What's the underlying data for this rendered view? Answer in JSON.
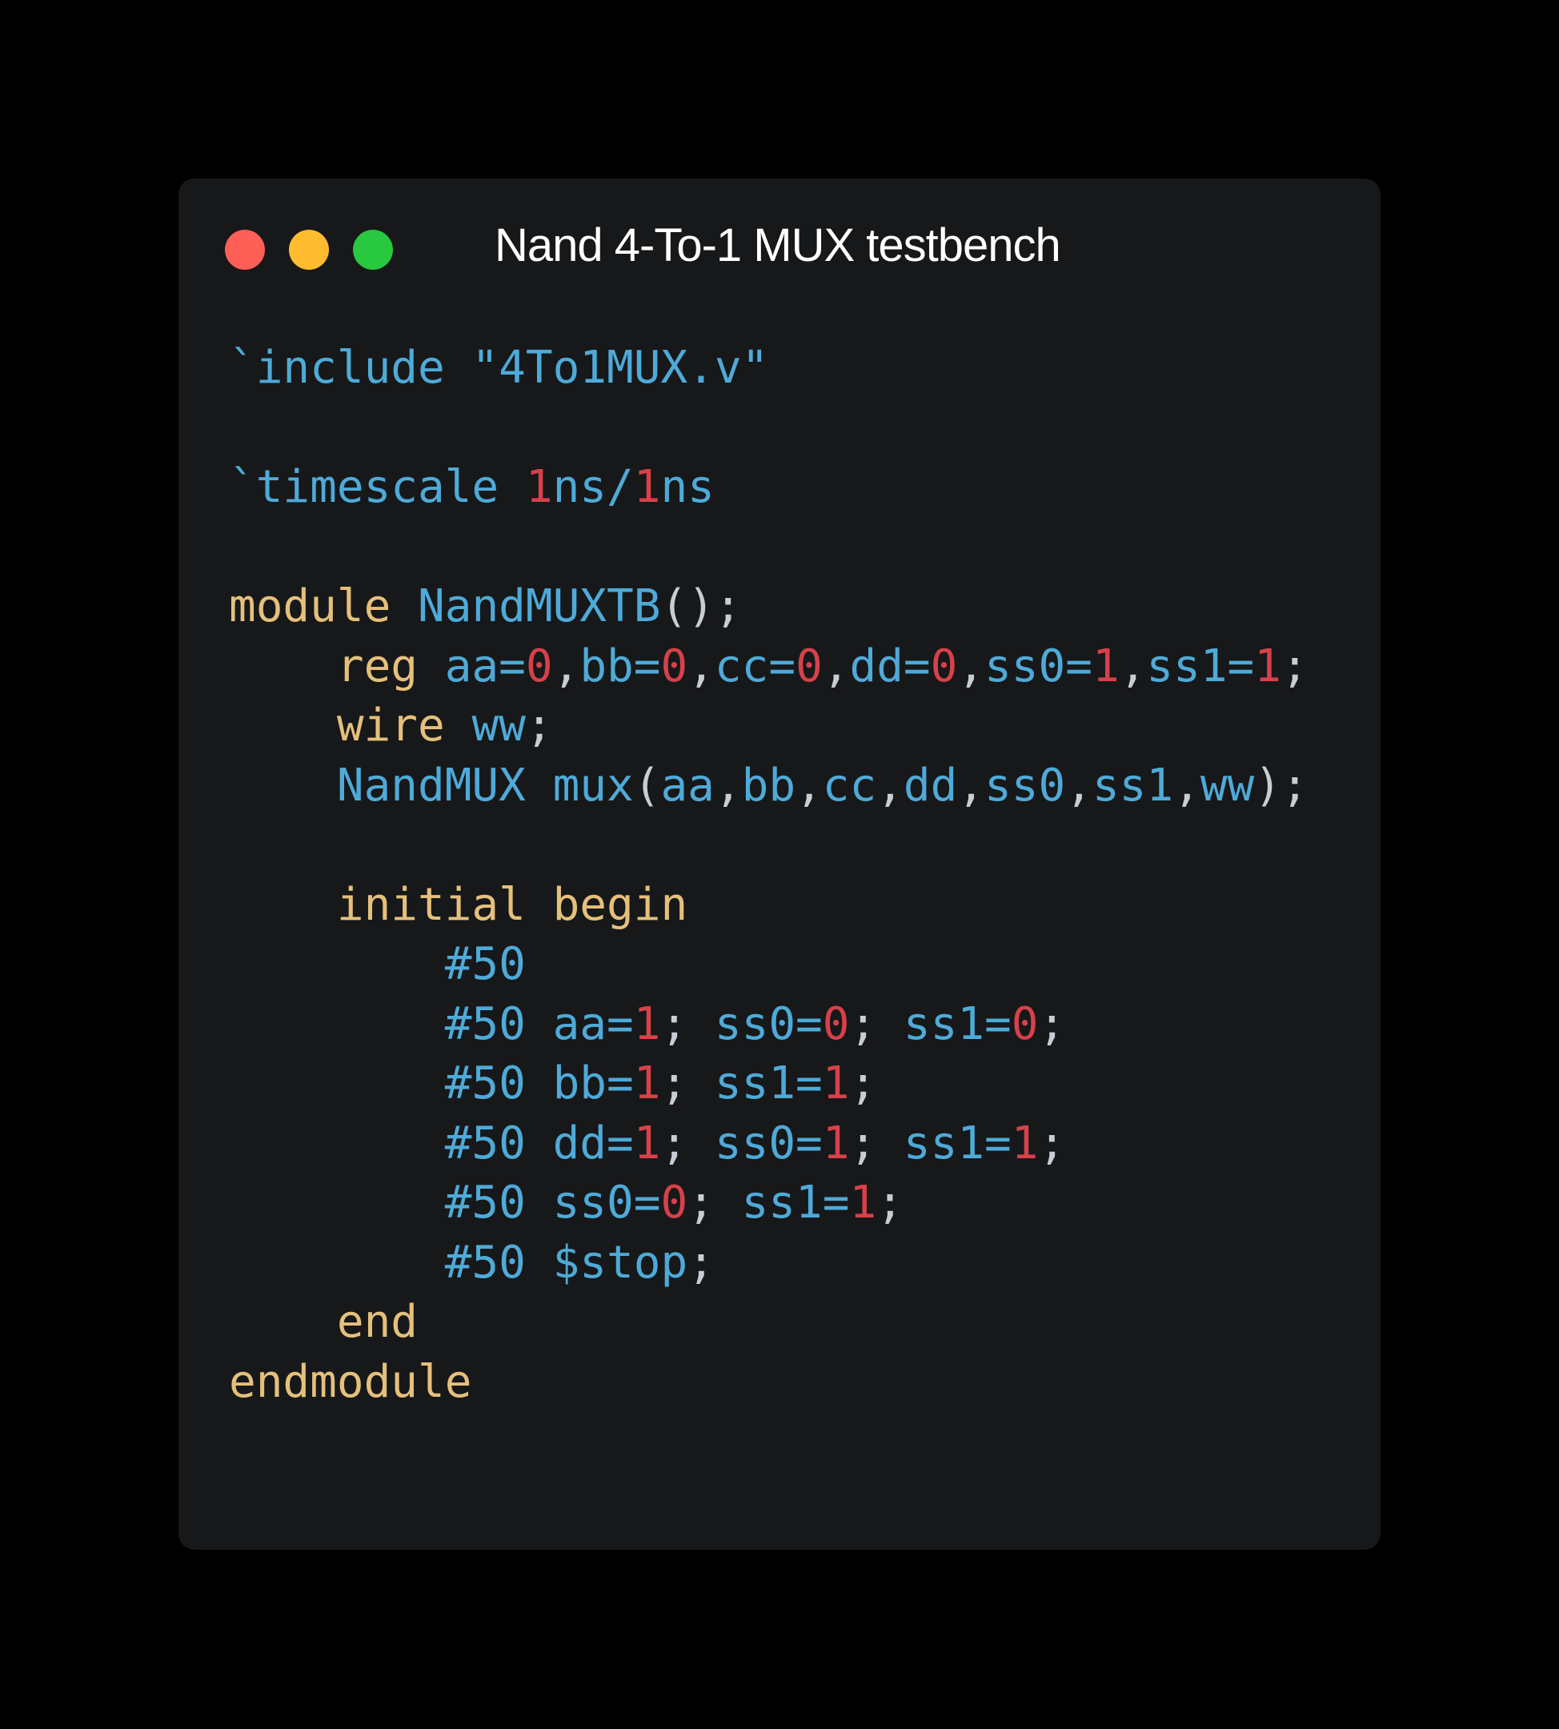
{
  "window": {
    "title": "Nand 4-To-1 MUX testbench",
    "background": "#17181a",
    "buttons": {
      "close_color": "#fe5f57",
      "minimize_color": "#febc2e",
      "maximize_color": "#28c840"
    }
  },
  "theme": {
    "keyword": "#e5c07b",
    "identifier": "#4eaad8",
    "number": "#d6414a",
    "punctuation": "#c9ccd3"
  },
  "code_lines": [
    [
      [
        "id",
        "`include \"4To1MUX.v\""
      ]
    ],
    [],
    [
      [
        "id",
        "`timescale "
      ],
      [
        "num",
        "1"
      ],
      [
        "id",
        "ns/"
      ],
      [
        "num",
        "1"
      ],
      [
        "id",
        "ns"
      ]
    ],
    [],
    [
      [
        "kw",
        "module "
      ],
      [
        "id",
        "NandMUXTB"
      ],
      [
        "punc",
        "();"
      ]
    ],
    [
      [
        "sp",
        "    "
      ],
      [
        "kw",
        "reg "
      ],
      [
        "id",
        "aa="
      ],
      [
        "num",
        "0"
      ],
      [
        "punc",
        ","
      ],
      [
        "id",
        "bb="
      ],
      [
        "num",
        "0"
      ],
      [
        "punc",
        ","
      ],
      [
        "id",
        "cc="
      ],
      [
        "num",
        "0"
      ],
      [
        "punc",
        ","
      ],
      [
        "id",
        "dd="
      ],
      [
        "num",
        "0"
      ],
      [
        "punc",
        ","
      ],
      [
        "id",
        "ss0="
      ],
      [
        "num",
        "1"
      ],
      [
        "punc",
        ","
      ],
      [
        "id",
        "ss1="
      ],
      [
        "num",
        "1"
      ],
      [
        "punc",
        ";"
      ]
    ],
    [
      [
        "sp",
        "    "
      ],
      [
        "kw",
        "wire "
      ],
      [
        "id",
        "ww"
      ],
      [
        "punc",
        ";"
      ]
    ],
    [
      [
        "sp",
        "    "
      ],
      [
        "id",
        "NandMUX mux"
      ],
      [
        "punc",
        "("
      ],
      [
        "id",
        "aa"
      ],
      [
        "punc",
        ","
      ],
      [
        "id",
        "bb"
      ],
      [
        "punc",
        ","
      ],
      [
        "id",
        "cc"
      ],
      [
        "punc",
        ","
      ],
      [
        "id",
        "dd"
      ],
      [
        "punc",
        ","
      ],
      [
        "id",
        "ss0"
      ],
      [
        "punc",
        ","
      ],
      [
        "id",
        "ss1"
      ],
      [
        "punc",
        ","
      ],
      [
        "id",
        "ww"
      ],
      [
        "punc",
        ");"
      ]
    ],
    [],
    [
      [
        "sp",
        "    "
      ],
      [
        "kw",
        "initial begin"
      ]
    ],
    [
      [
        "sp",
        "        "
      ],
      [
        "id",
        "#50"
      ]
    ],
    [
      [
        "sp",
        "        "
      ],
      [
        "id",
        "#50 aa="
      ],
      [
        "num",
        "1"
      ],
      [
        "punc",
        "; "
      ],
      [
        "id",
        "ss0="
      ],
      [
        "num",
        "0"
      ],
      [
        "punc",
        "; "
      ],
      [
        "id",
        "ss1="
      ],
      [
        "num",
        "0"
      ],
      [
        "punc",
        ";"
      ]
    ],
    [
      [
        "sp",
        "        "
      ],
      [
        "id",
        "#50 bb="
      ],
      [
        "num",
        "1"
      ],
      [
        "punc",
        "; "
      ],
      [
        "id",
        "ss1="
      ],
      [
        "num",
        "1"
      ],
      [
        "punc",
        ";"
      ]
    ],
    [
      [
        "sp",
        "        "
      ],
      [
        "id",
        "#50 dd="
      ],
      [
        "num",
        "1"
      ],
      [
        "punc",
        "; "
      ],
      [
        "id",
        "ss0="
      ],
      [
        "num",
        "1"
      ],
      [
        "punc",
        "; "
      ],
      [
        "id",
        "ss1="
      ],
      [
        "num",
        "1"
      ],
      [
        "punc",
        ";"
      ]
    ],
    [
      [
        "sp",
        "        "
      ],
      [
        "id",
        "#50 ss0="
      ],
      [
        "num",
        "0"
      ],
      [
        "punc",
        "; "
      ],
      [
        "id",
        "ss1="
      ],
      [
        "num",
        "1"
      ],
      [
        "punc",
        ";"
      ]
    ],
    [
      [
        "sp",
        "        "
      ],
      [
        "id",
        "#50 $stop"
      ],
      [
        "punc",
        ";"
      ]
    ],
    [
      [
        "sp",
        "    "
      ],
      [
        "kw",
        "end"
      ]
    ],
    [
      [
        "kw",
        "endmodule"
      ]
    ]
  ]
}
